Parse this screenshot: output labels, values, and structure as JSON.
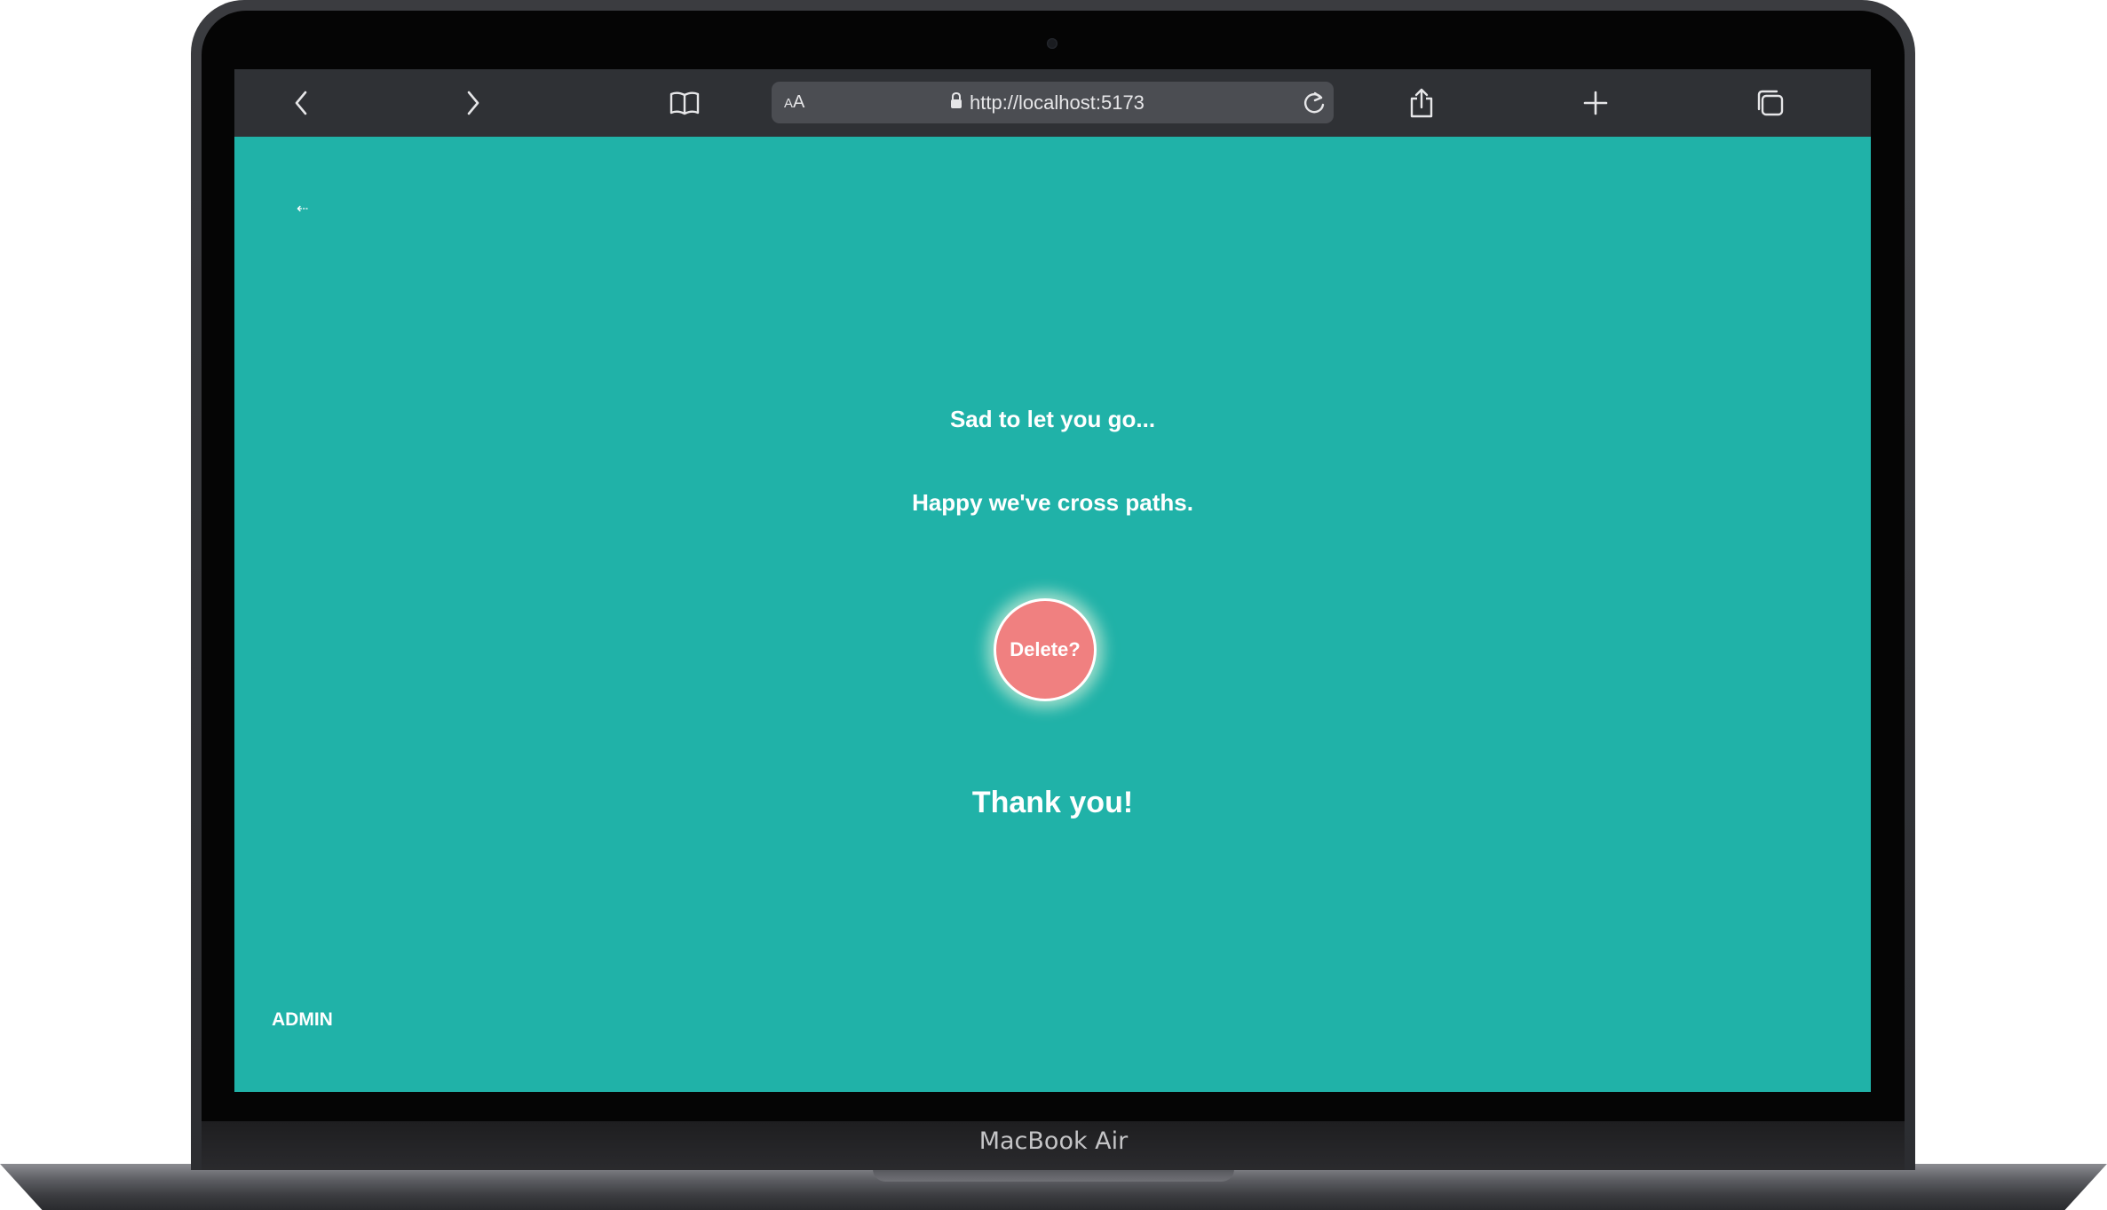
{
  "device": {
    "brand_label": "MacBook Air"
  },
  "browser": {
    "text_size_label_small": "A",
    "text_size_label_large": "A",
    "url": "http://localhost:5173",
    "icons": {
      "back": "chevron-left-icon",
      "forward": "chevron-right-icon",
      "bookmarks": "book-icon",
      "secure": "lock-icon",
      "reload": "reload-icon",
      "share": "share-icon",
      "new_tab": "plus-icon",
      "tabs": "tabs-icon"
    }
  },
  "page": {
    "background_color": "#20b2a8",
    "back_link": "⇠",
    "farewell_line": "Sad to let you go...",
    "gratitude_line": "Happy we've cross paths.",
    "delete_button": "Delete?",
    "delete_button_color": "#f08080",
    "thanks": "Thank you!",
    "admin_link": "ADMIN"
  }
}
